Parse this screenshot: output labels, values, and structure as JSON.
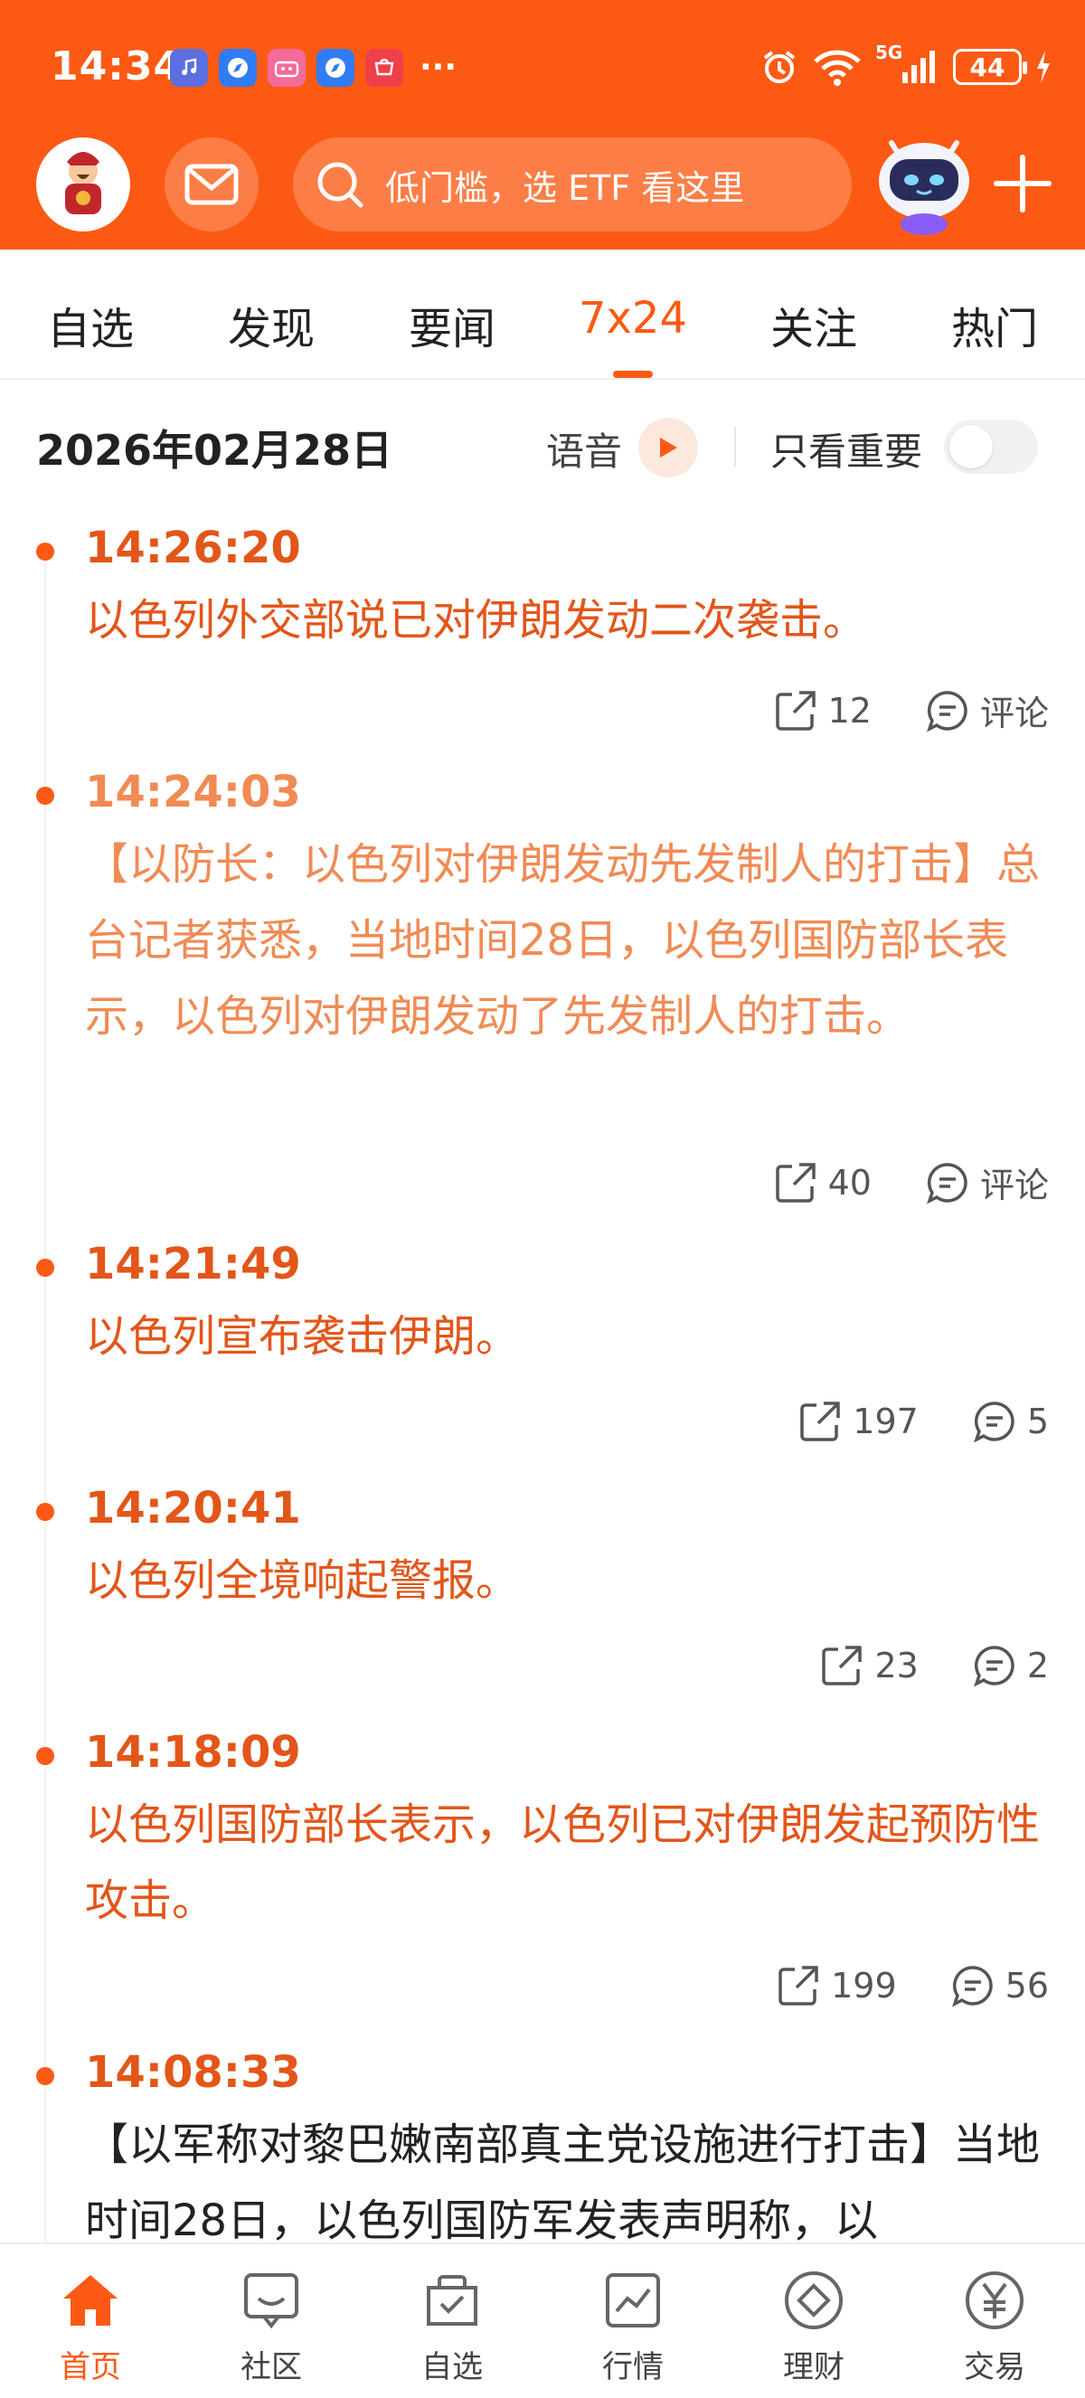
{
  "status_bar": {
    "time": "14:34",
    "more": "···",
    "network": "5G",
    "battery": "44"
  },
  "header": {
    "search_placeholder": "低门槛，选 ETF 看这里"
  },
  "tabs": [
    {
      "label": "自选"
    },
    {
      "label": "发现"
    },
    {
      "label": "要闻"
    },
    {
      "label": "7x24"
    },
    {
      "label": "关注"
    },
    {
      "label": "热门"
    }
  ],
  "active_tab": "7x24",
  "date_row": {
    "date": "2026年02月28日",
    "voice_label": "语音",
    "important_label": "只看重要",
    "important_only": false
  },
  "feed": [
    {
      "time": "14:26:20",
      "text": "以色列外交部说已对伊朗发动二次袭击。",
      "shares": "12",
      "comments": "评论"
    },
    {
      "time": "14:24:03",
      "text": "【以防长：以色列对伊朗发动先发制人的打击】总台记者获悉，当地时间28日，以色列国防部长表示，以色列对伊朗发动了先发制人的打击。",
      "shares": "40",
      "comments": "评论"
    },
    {
      "time": "14:21:49",
      "text": "以色列宣布袭击伊朗。",
      "shares": "197",
      "comments": "5"
    },
    {
      "time": "14:20:41",
      "text": "以色列全境响起警报。",
      "shares": "23",
      "comments": "2"
    },
    {
      "time": "14:18:09",
      "text": "以色列国防部长表示，以色列已对伊朗发起预防性攻击。",
      "shares": "199",
      "comments": "56"
    },
    {
      "time": "14:08:33",
      "text": "【以军称对黎巴嫩南部真主党设施进行打击】当地时间28日，以色列国防军发表声明称，以"
    }
  ],
  "bottom_nav": [
    {
      "label": "首页",
      "icon": "home-icon"
    },
    {
      "label": "社区",
      "icon": "community-icon"
    },
    {
      "label": "自选",
      "icon": "watchlist-icon"
    },
    {
      "label": "行情",
      "icon": "market-icon"
    },
    {
      "label": "理财",
      "icon": "wealth-icon"
    },
    {
      "label": "交易",
      "icon": "trade-icon"
    }
  ],
  "colors": {
    "brand": "#fc5a14",
    "news_text": "#e2561a",
    "news_text_soft": "#f08b55"
  }
}
